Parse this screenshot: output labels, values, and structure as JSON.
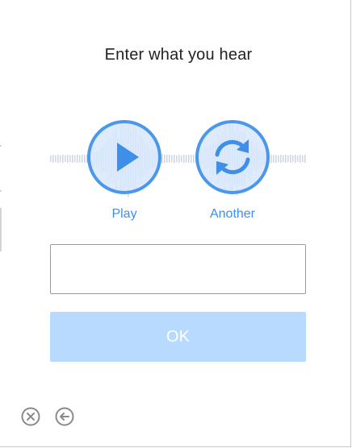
{
  "title": "Enter what you hear",
  "buttons": {
    "play": {
      "label": "Play",
      "icon": "play-icon"
    },
    "another": {
      "label": "Another",
      "icon": "refresh-icon"
    }
  },
  "answer": {
    "value": "",
    "placeholder": ""
  },
  "ok_label": "OK",
  "footer": {
    "close_icon": "close-icon",
    "back_icon": "back-icon"
  },
  "colors": {
    "accent": "#3d8fe8",
    "ok_disabled_bg": "#b9daff",
    "wave": "#cfd8e2",
    "circle_fill": "#d7e8fb"
  }
}
